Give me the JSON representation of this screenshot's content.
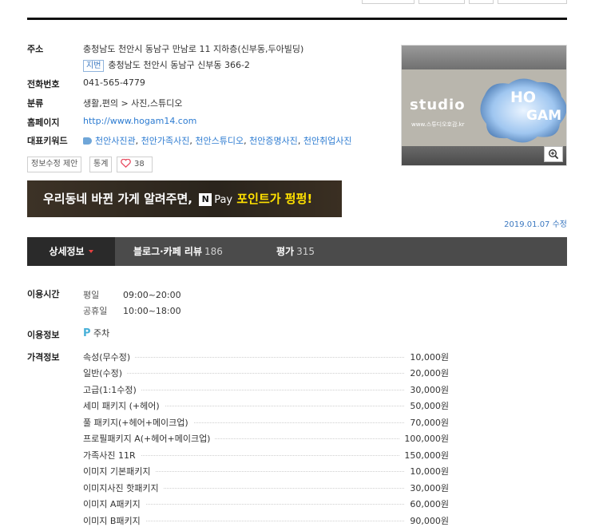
{
  "info": {
    "address_label": "주소",
    "road_address": "충청남도 천안시 동남구 만남로 11 지하층(신부동,두아빌딩)",
    "jibeon_badge": "지번",
    "jibeon_address": "충청남도 천안시 동남구 신부동 366-2",
    "phone_label": "전화번호",
    "phone": "041-565-4779",
    "category_label": "분류",
    "category": "생활,편의 > 사진,스튜디오",
    "homepage_label": "홈페이지",
    "homepage": "http://www.hogam14.com",
    "keywords_label": "대표키워드",
    "keywords": [
      "천안사진관",
      "천안가족사진",
      "천안스튜디오",
      "천안증명사진",
      "천안취업사진"
    ]
  },
  "buttons": {
    "edit_info": "정보수정 제안",
    "stats": "통계",
    "like_count": "38"
  },
  "photo": {
    "brand_studio": "studio",
    "brand_ho": "HO",
    "brand_gam": "GAM",
    "sub_text": "www.스튜디오호감.kr"
  },
  "banner": {
    "text_prefix": "우리동네 바뀐 가게 알려주면,",
    "npay_n": "N",
    "npay_pay": "Pay",
    "text_highlight": "포인트가 펑펑!"
  },
  "updated": "2019.01.07 수정",
  "tabs": [
    {
      "label": "상세정보",
      "count": ""
    },
    {
      "label": "블로그·카페 리뷰",
      "count": "186"
    },
    {
      "label": "평가",
      "count": "315"
    }
  ],
  "detail": {
    "hours_label": "이용시간",
    "hours": [
      {
        "day": "평일",
        "time": "09:00~20:00"
      },
      {
        "day": "공휴일",
        "time": "10:00~18:00"
      }
    ],
    "usage_label": "이용정보",
    "parking_icon": "P",
    "parking": "주차",
    "price_label": "가격정보",
    "prices": [
      {
        "name": "속성(무수정)",
        "price": "10,000원"
      },
      {
        "name": "일반(수정)",
        "price": "20,000원"
      },
      {
        "name": "고급(1:1수정)",
        "price": "30,000원"
      },
      {
        "name": "세미 패키지 (+헤어)",
        "price": "50,000원"
      },
      {
        "name": "풀 패키지(+헤어+메이크업)",
        "price": "70,000원"
      },
      {
        "name": "프로필패키지 A(+헤어+메이크업)",
        "price": "100,000원"
      },
      {
        "name": "가족사진 11R",
        "price": "150,000원"
      },
      {
        "name": "이미지 기본패키지",
        "price": "10,000원"
      },
      {
        "name": "이미지사진 핫패키지",
        "price": "30,000원"
      },
      {
        "name": "이미지 A패키지",
        "price": "60,000원"
      },
      {
        "name": "이미지 B패키지",
        "price": "90,000원"
      }
    ]
  }
}
